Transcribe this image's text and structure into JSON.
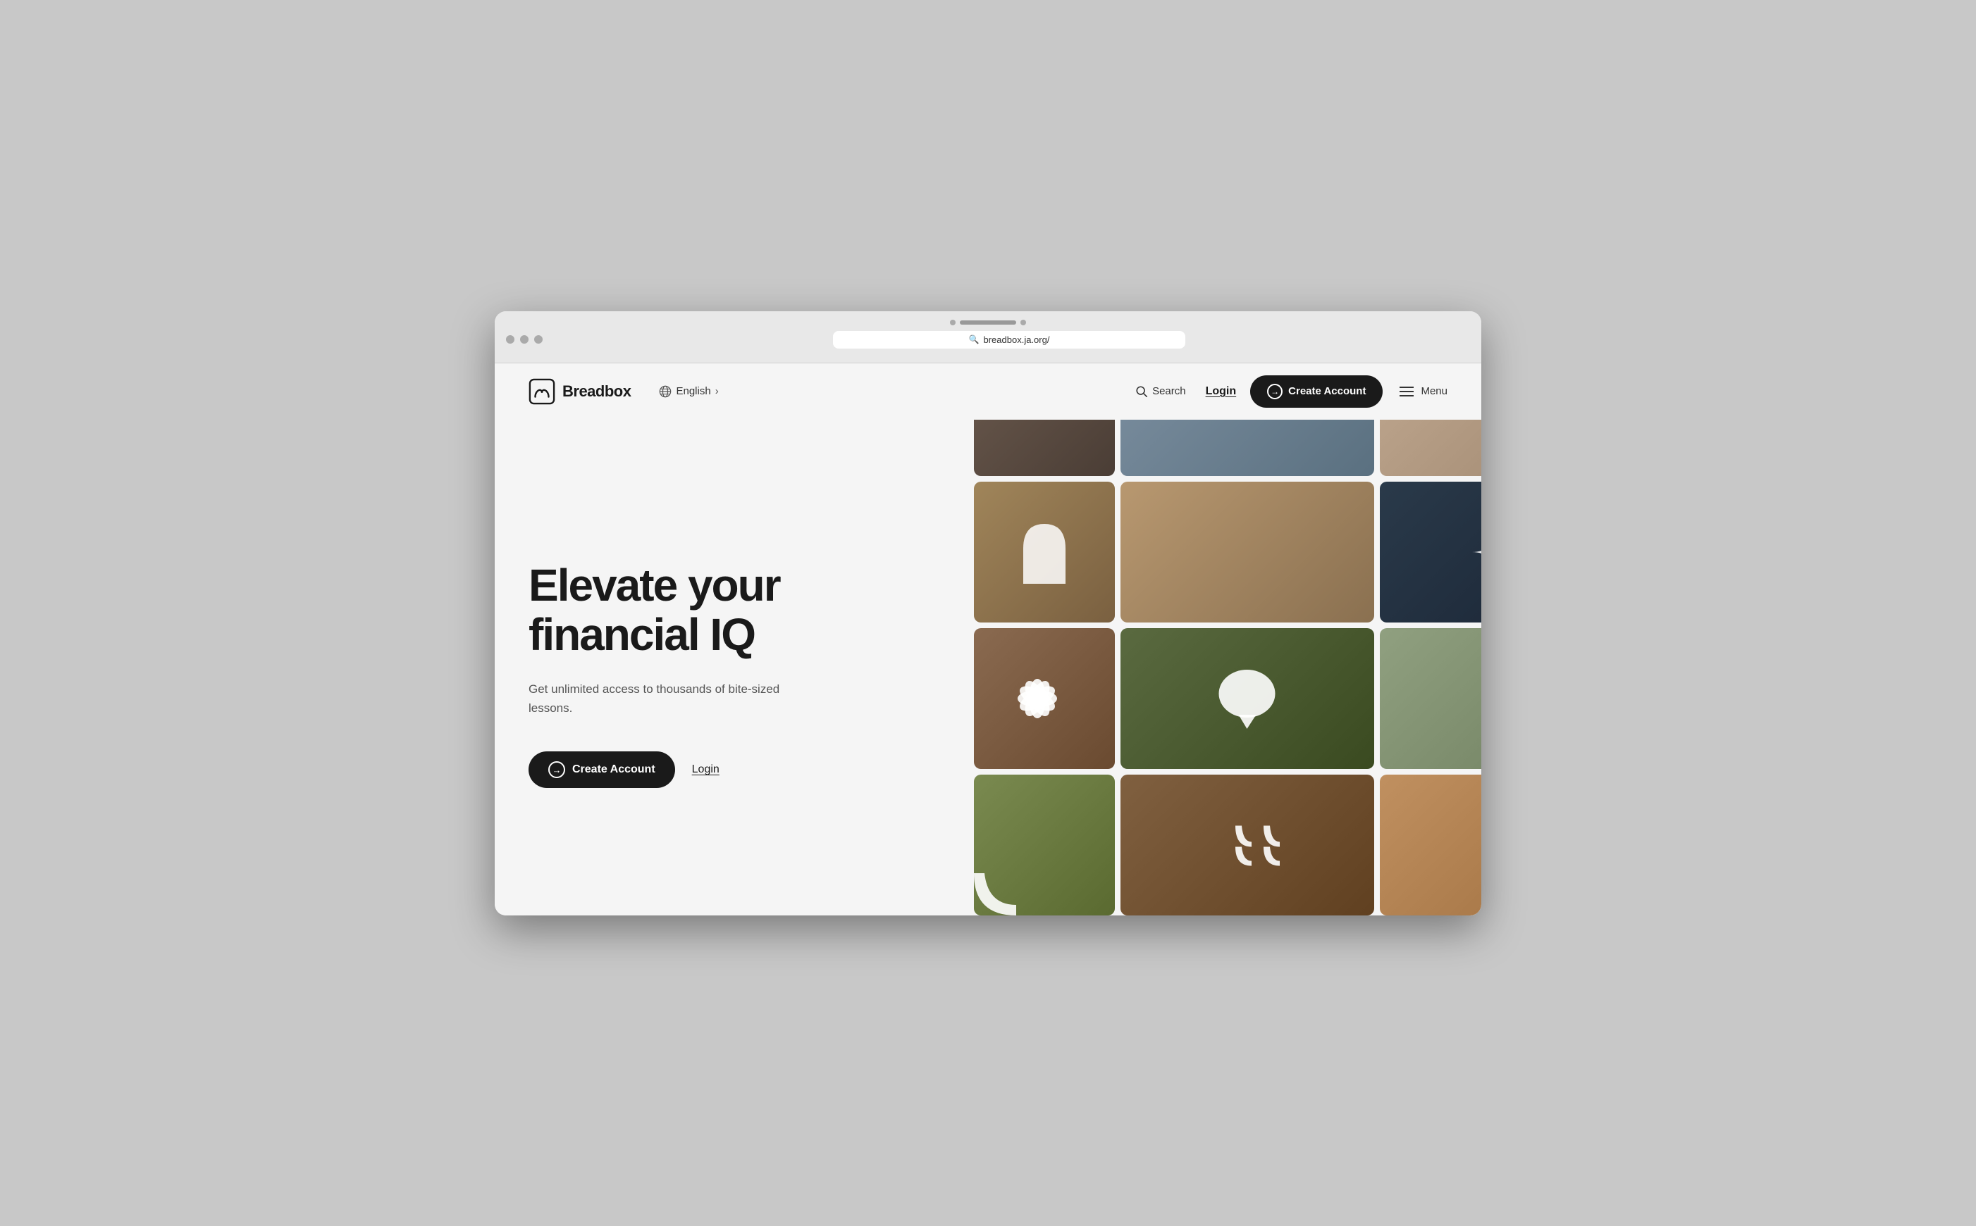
{
  "browser": {
    "url": "breadbox.ja.org/",
    "tab_dots": [
      "gray",
      "gray"
    ],
    "tab_line": "gray"
  },
  "navbar": {
    "logo_text": "Breadbox",
    "lang_label": "English",
    "lang_arrow": "›",
    "search_label": "Search",
    "login_label": "Login",
    "create_account_label": "Create Account",
    "menu_label": "Menu"
  },
  "hero": {
    "title_line1": "Elevate your",
    "title_line2": "financial IQ",
    "subtitle": "Get unlimited access to thousands of bite-sized lessons.",
    "create_account_btn": "Create Account",
    "login_btn": "Login"
  },
  "photos": {
    "row1": [
      {
        "id": "p1",
        "color_start": "#6b5a4e",
        "color_end": "#4a3d35"
      },
      {
        "id": "p2",
        "color_start": "#7c8fa0",
        "color_end": "#5a7080"
      },
      {
        "id": "p3",
        "color_start": "#a08060",
        "color_end": "#806040"
      }
    ],
    "row2": [
      {
        "id": "p4",
        "color_start": "#a0855a",
        "color_end": "#7a6040",
        "shape": "arch"
      },
      {
        "id": "p5",
        "color_start": "#c8b090",
        "color_end": "#a09070",
        "shape": "none"
      },
      {
        "id": "p6",
        "color_start": "#3a4a5a",
        "color_end": "#2a3545",
        "shape": "star4"
      }
    ],
    "row3": [
      {
        "id": "p7",
        "color_start": "#8a6a50",
        "color_end": "#6a4a30",
        "shape": "flower"
      },
      {
        "id": "p8",
        "color_start": "#6a7a50",
        "color_end": "#3a4a20",
        "shape": "blob"
      },
      {
        "id": "p9",
        "color_start": "#90a080",
        "color_end": "#708060",
        "shape": "none"
      }
    ],
    "row4": [
      {
        "id": "p10",
        "color_start": "#7a8a50",
        "color_end": "#5a6a30",
        "shape": "quoteleft_partial"
      },
      {
        "id": "p11",
        "color_start": "#806040",
        "color_end": "#604020",
        "shape": "quoteleft"
      },
      {
        "id": "p12",
        "color_start": "#c09060",
        "color_end": "#a07040",
        "shape": "quoteleft2"
      }
    ]
  },
  "colors": {
    "background": "#f5f5f5",
    "text_primary": "#1a1a1a",
    "text_secondary": "#555555",
    "accent": "#1a1a1a",
    "white": "#ffffff"
  }
}
